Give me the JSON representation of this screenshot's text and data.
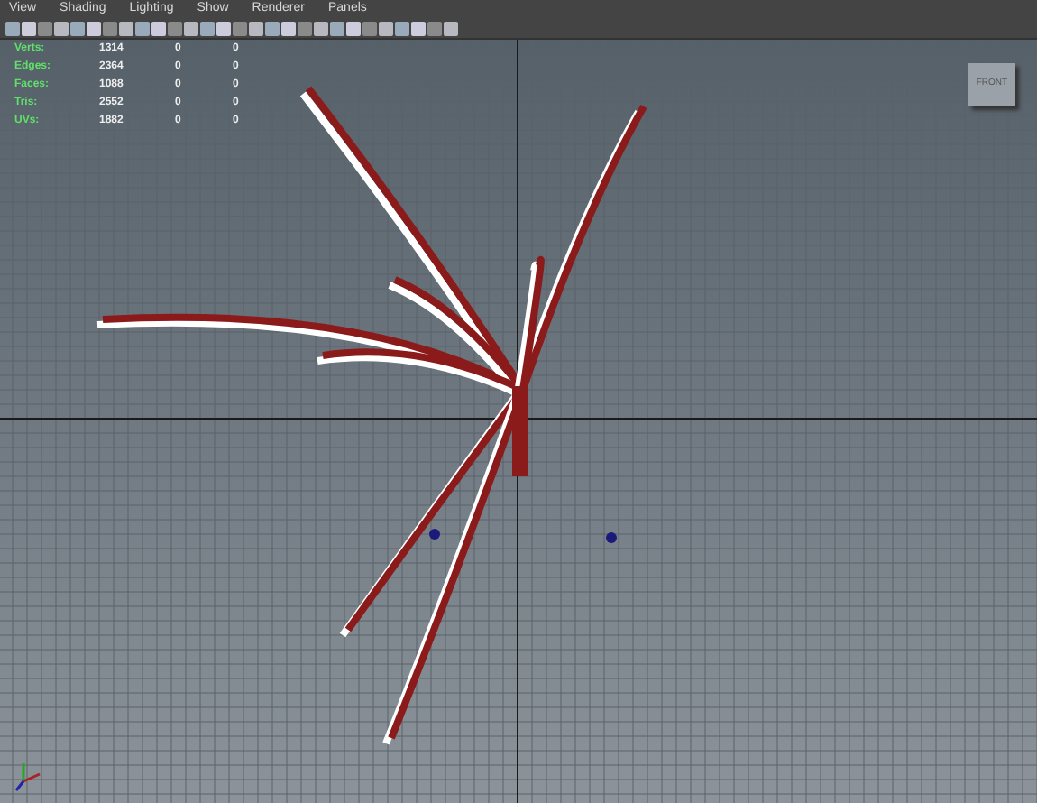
{
  "menu": [
    "View",
    "Shading",
    "Lighting",
    "Show",
    "Renderer",
    "Panels"
  ],
  "hud": [
    {
      "label": "Verts:",
      "values": [
        "1314",
        "0",
        "0"
      ]
    },
    {
      "label": "Edges:",
      "values": [
        "2364",
        "0",
        "0"
      ]
    },
    {
      "label": "Faces:",
      "values": [
        "1088",
        "0",
        "0"
      ]
    },
    {
      "label": "Tris:",
      "values": [
        "2552",
        "0",
        "0"
      ]
    },
    {
      "label": "UVs:",
      "values": [
        "1882",
        "0",
        "0"
      ]
    }
  ],
  "view_cube": {
    "label": "FRONT"
  }
}
